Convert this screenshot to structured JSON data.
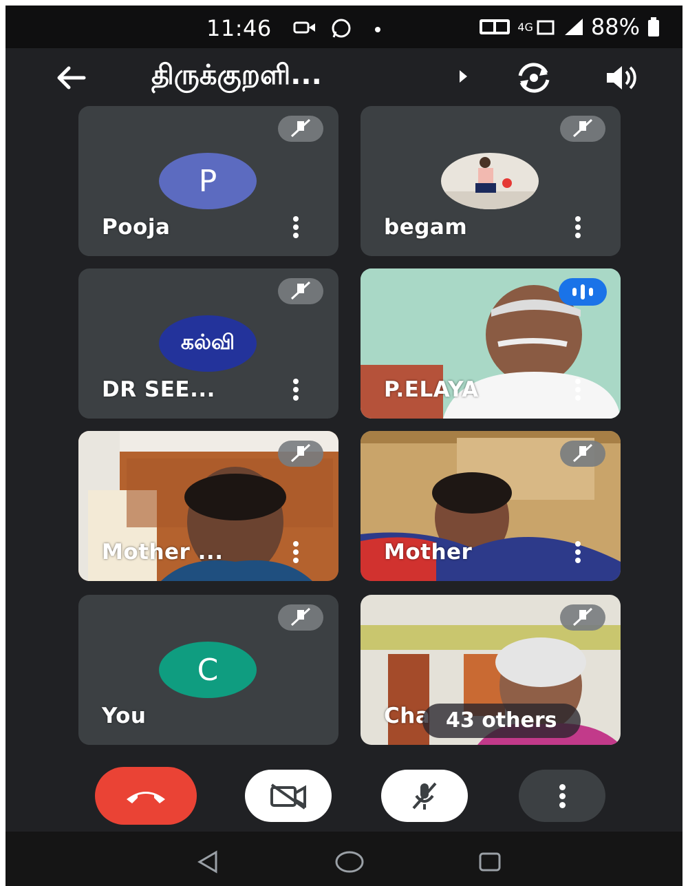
{
  "status_bar": {
    "time": "11:46",
    "signal_label": "4G",
    "battery": "88%",
    "icons": [
      "video-recording-icon",
      "whatsapp-icon",
      "dot-icon",
      "volte-icon",
      "signal-icon",
      "battery-icon"
    ]
  },
  "app_bar": {
    "title": "திருக்குறளி...",
    "back_icon": "arrow-left-icon",
    "switch_camera_icon": "camera-switch-icon",
    "speaker_icon": "speaker-icon"
  },
  "participants": [
    {
      "name": "Pooja",
      "initial": "P",
      "avatar_color": "#5c6bc0",
      "muted": true,
      "kind": "initial"
    },
    {
      "name": "begam",
      "muted": true,
      "kind": "photo"
    },
    {
      "name": "DR SEE...",
      "muted": true,
      "kind": "logo",
      "logo_text": "கல்வி"
    },
    {
      "name": "P.ELAYA",
      "muted": false,
      "speaking": true,
      "kind": "video"
    },
    {
      "name": "Mother ...",
      "muted": true,
      "kind": "video"
    },
    {
      "name": "Mother",
      "muted": true,
      "kind": "video"
    },
    {
      "name": "You",
      "initial": "C",
      "avatar_color": "#0f9d80",
      "muted": true,
      "kind": "initial"
    },
    {
      "name": "Cha",
      "muted": true,
      "kind": "video",
      "overflow_label": "43 others"
    }
  ],
  "controls": {
    "end_call_color": "#ea4335",
    "buttons": [
      "end-call-icon",
      "camera-off-icon",
      "mic-off-icon",
      "more-icon"
    ]
  },
  "nav_bar": {
    "buttons": [
      "back-nav-icon",
      "home-nav-icon",
      "recents-nav-icon"
    ]
  }
}
